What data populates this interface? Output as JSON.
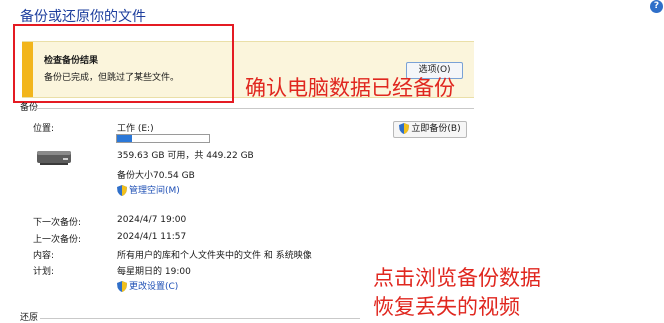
{
  "header": {
    "title": "备份或还原你的文件",
    "help_icon": "?"
  },
  "notice": {
    "title": "检查备份结果",
    "message": "备份已完成，但跳过了某些文件。",
    "options_button": "选项(O)"
  },
  "annotations": {
    "confirm": "确认电脑数据已经备份",
    "browse_line1": "点击浏览备份数据",
    "browse_line2": "恢复丢失的视频"
  },
  "backup": {
    "section_label": "备份",
    "location_label": "位置:",
    "location_value": "工作 (E:)",
    "usage_fraction": 0.16,
    "free_space": "359.63 GB 可用，共 449.22 GB",
    "backup_size": "备份大小70.54 GB",
    "manage_space_link": "管理空间(M)",
    "backup_now_button": "立即备份(B)",
    "next_backup_label": "下一次备份:",
    "next_backup_value": "2024/4/7 19:00",
    "last_backup_label": "上一次备份:",
    "last_backup_value": "2024/4/1 11:57",
    "contents_label": "内容:",
    "contents_value": "所有用户的库和个人文件夹中的文件 和 系统映像",
    "schedule_label": "计划:",
    "schedule_value": "每星期日的 19:00",
    "change_settings_link": "更改设置(C)"
  },
  "restore": {
    "section_label": "还原"
  },
  "colors": {
    "annotation": "#e0271f",
    "link": "#1e4fb5",
    "notice_accent": "#f2b51c",
    "progress": "#2b78d8"
  }
}
